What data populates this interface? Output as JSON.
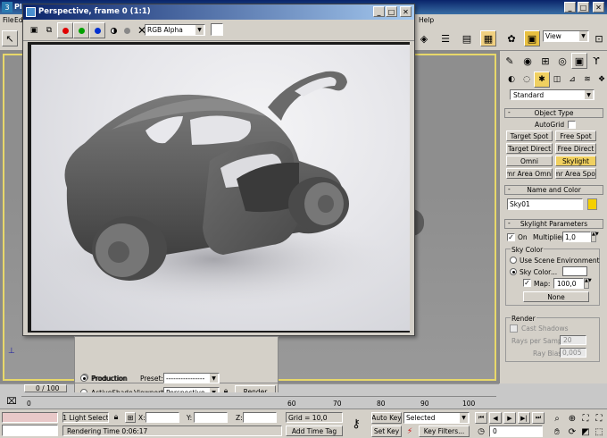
{
  "app": {
    "title": "Pl",
    "menu": {
      "file": "File",
      "edit": "Ed",
      "help": "Help"
    }
  },
  "toolbar": {
    "view_dropdown": "View"
  },
  "render_window": {
    "title": "Perspective, frame 0 (1:1)",
    "channel_dropdown": "RGB Alpha",
    "colors": {
      "red": "#e00000",
      "green": "#00a000",
      "blue": "#0030d0"
    }
  },
  "command_panel": {
    "category_dropdown": "Standard",
    "object_type": {
      "title": "Object Type",
      "autogrid": "AutoGrid",
      "buttons": [
        "Target Spot",
        "Free Spot",
        "Target Direct",
        "Free Direct",
        "Omni",
        "Skylight",
        "mr Area Omni",
        "mr Area Spot"
      ],
      "active": "Skylight"
    },
    "name_color": {
      "title": "Name and Color",
      "name_value": "Sky01",
      "swatch": "#f5d000"
    },
    "skylight_params": {
      "title": "Skylight Parameters",
      "on_label": "On",
      "multiplier_label": "Multiplier:",
      "multiplier_value": "1,0",
      "sky_color_group": "Sky Color",
      "use_scene_env": "Use Scene Environment",
      "sky_color_label": "Sky Color",
      "map_label": "Map:",
      "map_value": "100,0",
      "none_button": "None",
      "render_group": "Render",
      "cast_shadows": "Cast Shadows",
      "rays_label": "Rays per Sample:",
      "rays_value": "20",
      "ray_bias_label": "Ray Bias:",
      "ray_bias_value": "0,005"
    }
  },
  "render_setup": {
    "production": "Production",
    "activeshade": "ActiveShade",
    "preset_label": "Preset:",
    "preset_value": "----------------",
    "viewport_label": "Viewport:",
    "viewport_value": "Perspective",
    "render_button": "Render"
  },
  "timeline": {
    "frame_counter": "0 / 100",
    "ticks": [
      "0",
      "60",
      "70",
      "80",
      "90",
      "100"
    ]
  },
  "status": {
    "selection": "1 Light Select",
    "x_label": "X:",
    "y_label": "Y:",
    "z_label": "Z:",
    "grid": "Grid = 10,0",
    "auto_key": "Auto Key",
    "set_key": "Set Key",
    "key_mode": "Selected",
    "key_filters": "Key Filters...",
    "rendering_time": "Rendering Time  0:06:17",
    "add_time_tag": "Add Time Tag",
    "frame_value": "0"
  }
}
